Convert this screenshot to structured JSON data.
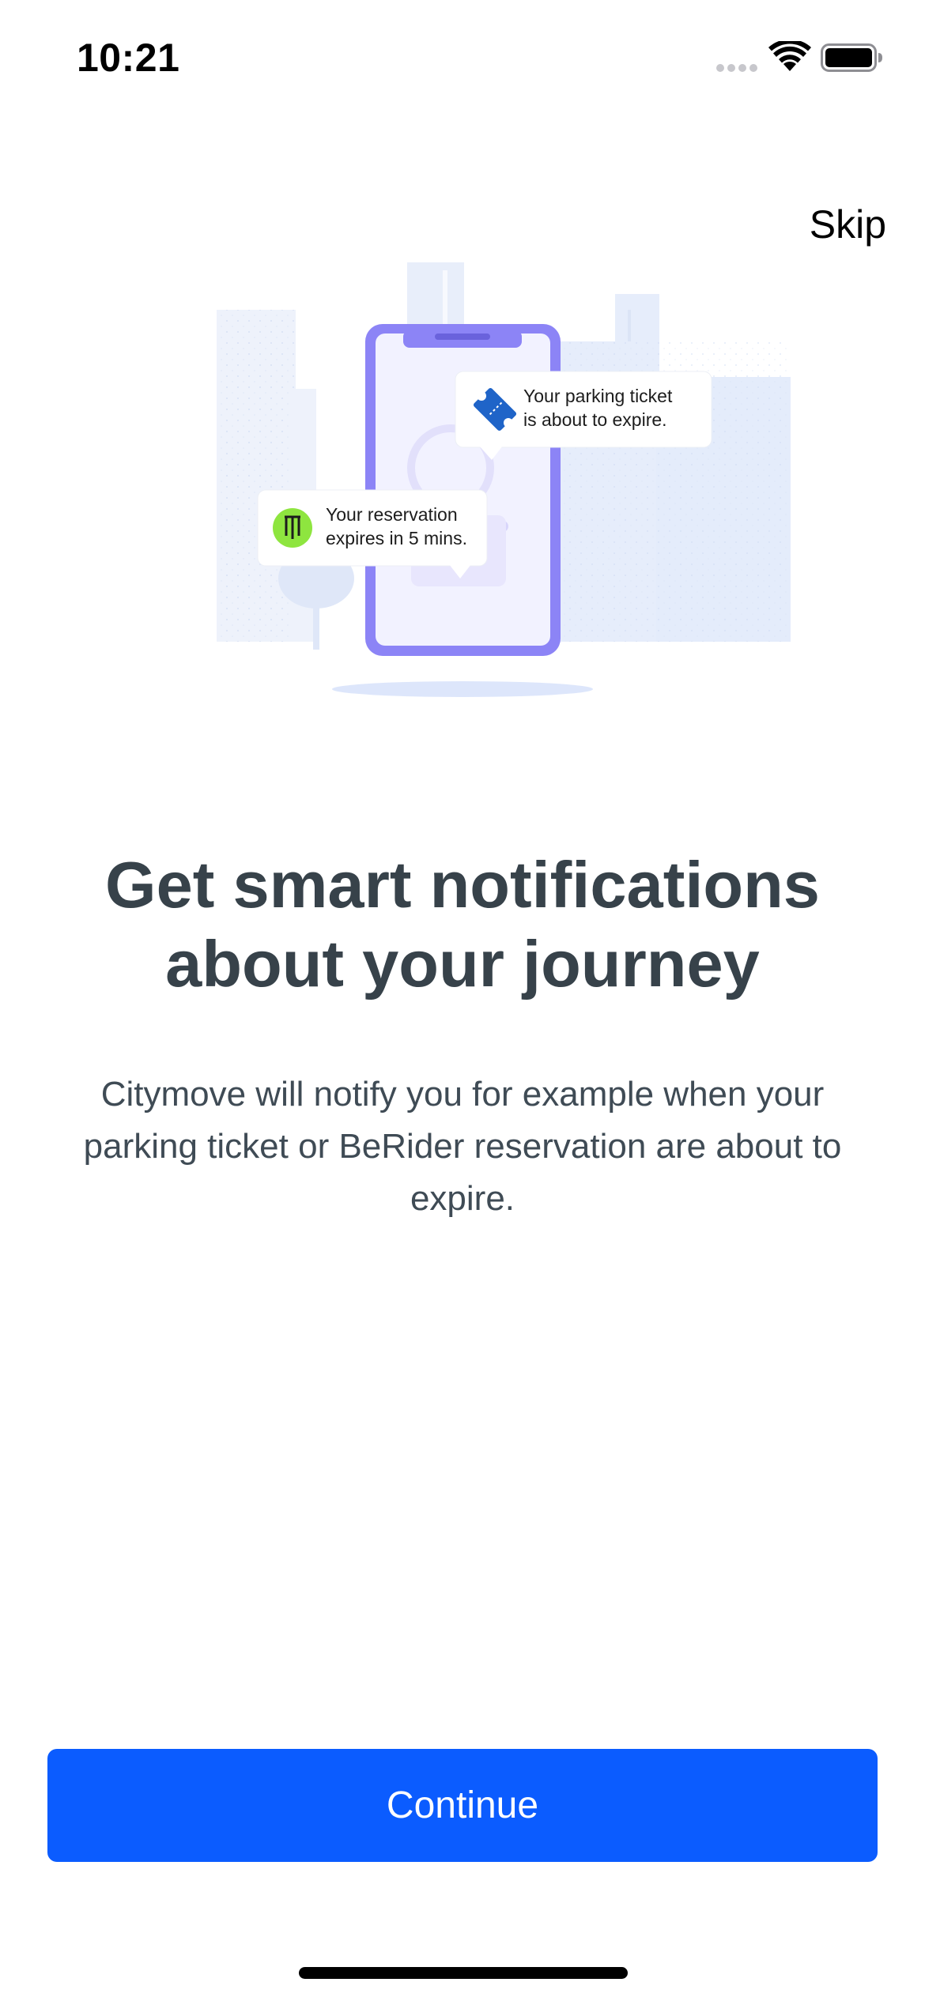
{
  "status_bar": {
    "time": "10:21"
  },
  "header": {
    "skip_label": "Skip"
  },
  "illustration": {
    "parking_notification": {
      "line1": "Your parking ticket",
      "line2": "is about to expire."
    },
    "reservation_notification": {
      "line1": "Your reservation",
      "line2": "expires in 5 mins."
    },
    "colors": {
      "phone_frame": "#8c84f6",
      "phone_screen": "#f2f2ff",
      "city_background": "#e4ecfb",
      "parking_icon": "#1f64c8",
      "scooter_icon_bg": "#8ee53f"
    }
  },
  "main": {
    "title_line1": "Get smart notifications",
    "title_line2": "about your journey",
    "description": "Citymove will notify you for example when your parking ticket or BeRider reservation are about to expire."
  },
  "footer": {
    "continue_label": "Continue"
  },
  "colors": {
    "primary_button": "#0b5cff",
    "title_text": "#37424a",
    "body_text": "#3f4b55"
  }
}
